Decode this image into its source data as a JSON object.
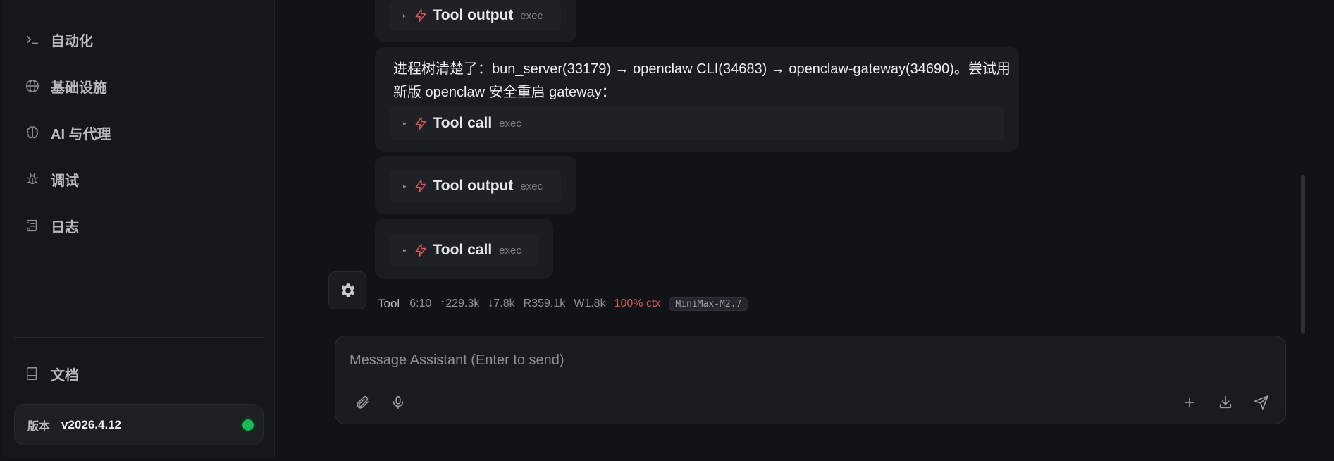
{
  "sidebar": {
    "items": [
      {
        "label": "自动化",
        "icon": "terminal-icon"
      },
      {
        "label": "基础设施",
        "icon": "globe-icon"
      },
      {
        "label": "AI 与代理",
        "icon": "brain-icon"
      },
      {
        "label": "调试",
        "icon": "bug-icon"
      },
      {
        "label": "日志",
        "icon": "scroll-icon"
      }
    ],
    "docs": {
      "label": "文档",
      "icon": "book-icon"
    },
    "version": {
      "label": "版本",
      "value": "v2026.4.12",
      "status_color": "#1bb85a"
    }
  },
  "chat": {
    "messages": [
      {
        "tool_title": "Tool output",
        "tool_tag": "exec"
      },
      {
        "text": "进程树清楚了：bun_server(33179) → openclaw CLI(34683) → openclaw-gateway(34690)。尝试用新版 openclaw 安全重启 gateway：",
        "tool_title": "Tool call",
        "tool_tag": "exec"
      },
      {
        "tool_title": "Tool output",
        "tool_tag": "exec"
      },
      {
        "tool_title": "Tool call",
        "tool_tag": "exec"
      }
    ],
    "meta": {
      "role": "Tool",
      "time": "6:10",
      "tokens_in": "↑229.3k",
      "tokens_out": "↓7.8k",
      "read": "R359.1k",
      "write": "W1.8k",
      "ctx": "100% ctx",
      "model": "MiniMax-M2.7"
    }
  },
  "composer": {
    "placeholder": "Message Assistant (Enter to send)"
  },
  "colors": {
    "accent_red": "#d6575b",
    "background": "#121317",
    "sidebar": "#16171c"
  }
}
